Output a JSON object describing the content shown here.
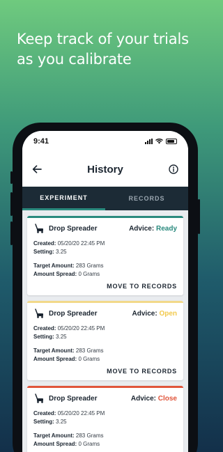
{
  "headline": "Keep track of your trials as you calibrate",
  "status": {
    "time": "9:41"
  },
  "nav": {
    "title": "History"
  },
  "tabs": [
    {
      "label": "EXPERIMENT",
      "active": true
    },
    {
      "label": "RECORDS",
      "active": false
    }
  ],
  "cards": [
    {
      "title": "Drop Spreader",
      "advice_label": "Advice:",
      "advice_value": "Ready",
      "advice_color": "#2a8a7e",
      "created_label": "Created:",
      "created_value": "05/20/20 22:45 PM",
      "setting_label": "Setting:",
      "setting_value": "3.25",
      "target_label": "Target Amount:",
      "target_value": "283 Grams",
      "spread_label": "Amount Spread:",
      "spread_value": "0 Grams",
      "action": "MOVE TO RECORDS"
    },
    {
      "title": "Drop Spreader",
      "advice_label": "Advice:",
      "advice_value": "Open",
      "advice_color": "#f2c94c",
      "created_label": "Created:",
      "created_value": "05/20/20 22:45 PM",
      "setting_label": "Setting:",
      "setting_value": "3.25",
      "target_label": "Target Amount:",
      "target_value": "283 Grams",
      "spread_label": "Amount Spread:",
      "spread_value": "0 Grams",
      "action": "MOVE TO RECORDS"
    },
    {
      "title": "Drop Spreader",
      "advice_label": "Advice:",
      "advice_value": "Close",
      "advice_color": "#e0553b",
      "created_label": "Created:",
      "created_value": "05/20/20 22:45 PM",
      "setting_label": "Setting:",
      "setting_value": "3.25",
      "target_label": "Target Amount:",
      "target_value": "283 Grams",
      "spread_label": "Amount Spread:",
      "spread_value": "0 Grams"
    }
  ],
  "icons": {
    "back": "arrow-left-icon",
    "info": "info-icon",
    "spreader": "drop-spreader-icon"
  },
  "colors": {
    "tab_bar": "#1c2b36",
    "accent": "#2a8a7e"
  }
}
